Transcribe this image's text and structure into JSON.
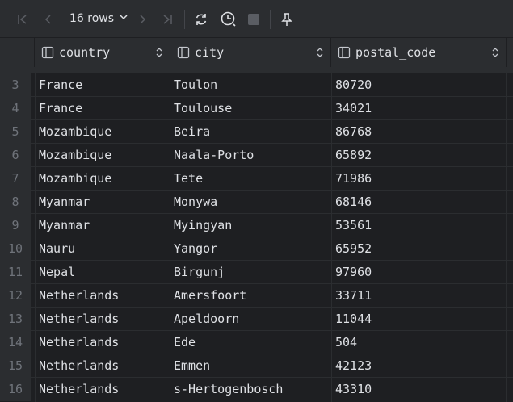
{
  "toolbar": {
    "first_page_icon": "first-page-icon",
    "prev_page_icon": "previous-page-icon",
    "rows_label": "16 rows",
    "next_page_icon": "next-page-icon",
    "last_page_icon": "last-page-icon",
    "refresh_icon": "refresh-icon",
    "history_icon": "history-icon",
    "stop_icon": "stop-icon",
    "pin_icon": "pin-icon"
  },
  "columns": [
    {
      "label": "country"
    },
    {
      "label": "city"
    },
    {
      "label": "postal_code"
    }
  ],
  "rows": [
    {
      "n": "3",
      "country": "France",
      "city": "Toulon",
      "postal_code": "80720"
    },
    {
      "n": "4",
      "country": "France",
      "city": "Toulouse",
      "postal_code": "34021"
    },
    {
      "n": "5",
      "country": "Mozambique",
      "city": "Beira",
      "postal_code": "86768"
    },
    {
      "n": "6",
      "country": "Mozambique",
      "city": "Naala-Porto",
      "postal_code": "65892"
    },
    {
      "n": "7",
      "country": "Mozambique",
      "city": "Tete",
      "postal_code": "71986"
    },
    {
      "n": "8",
      "country": "Myanmar",
      "city": "Monywa",
      "postal_code": "68146"
    },
    {
      "n": "9",
      "country": "Myanmar",
      "city": "Myingyan",
      "postal_code": "53561"
    },
    {
      "n": "10",
      "country": "Nauru",
      "city": "Yangor",
      "postal_code": "65952"
    },
    {
      "n": "11",
      "country": "Nepal",
      "city": "Birgunj",
      "postal_code": "97960"
    },
    {
      "n": "12",
      "country": "Netherlands",
      "city": "Amersfoort",
      "postal_code": "33711"
    },
    {
      "n": "13",
      "country": "Netherlands",
      "city": "Apeldoorn",
      "postal_code": "11044"
    },
    {
      "n": "14",
      "country": "Netherlands",
      "city": "Ede",
      "postal_code": "504"
    },
    {
      "n": "15",
      "country": "Netherlands",
      "city": "Emmen",
      "postal_code": "42123"
    },
    {
      "n": "16",
      "country": "Netherlands",
      "city": "s-Hertogenbosch",
      "postal_code": "43310"
    }
  ]
}
